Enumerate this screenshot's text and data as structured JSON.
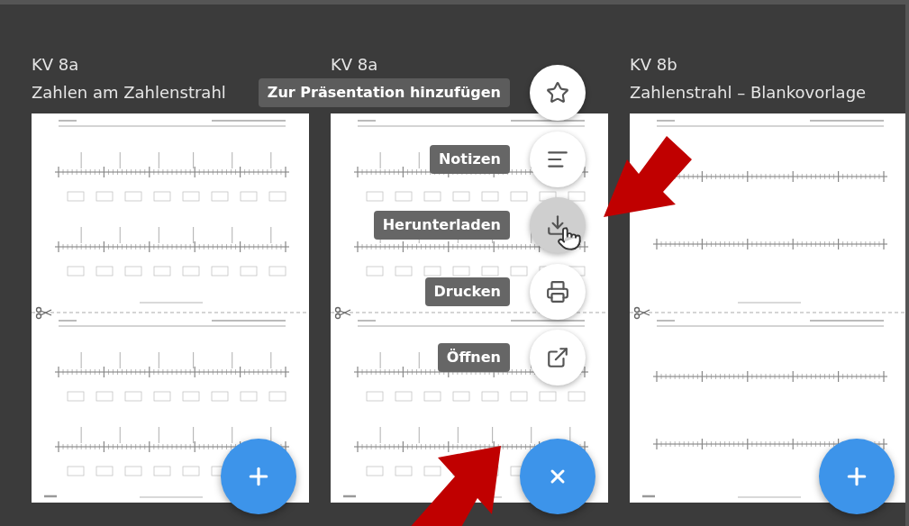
{
  "cards": [
    {
      "code": "KV 8a",
      "title": "Zahlen am Zahlenstrahl",
      "kind": "worksheet"
    },
    {
      "code": "KV 8a",
      "kind": "menu_open"
    },
    {
      "code": "KV 8b",
      "title": "Zahlenstrahl – Blankovorlage",
      "kind": "blank"
    }
  ],
  "menu": {
    "items": [
      {
        "label": "Zur Präsentation hinzufügen",
        "kind": "star",
        "hovered": false
      },
      {
        "label": "Notizen",
        "kind": "notes",
        "hovered": false
      },
      {
        "label": "Herunterladen",
        "kind": "download",
        "hovered": true
      },
      {
        "label": "Drucken",
        "kind": "print",
        "hovered": false
      },
      {
        "label": "Öffnen",
        "kind": "open",
        "hovered": false
      }
    ]
  }
}
